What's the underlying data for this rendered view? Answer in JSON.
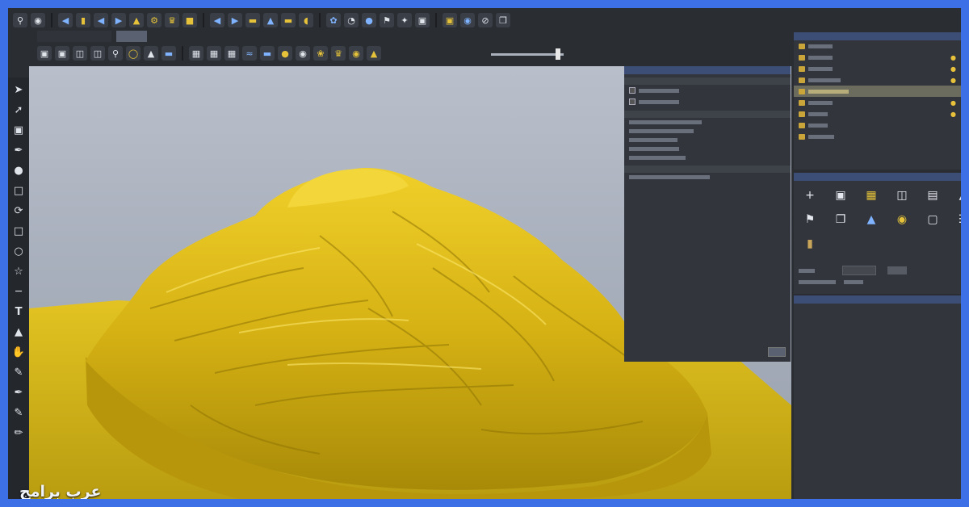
{
  "watermark": {
    "text": "عرب برامج"
  },
  "colors": {
    "frame": "#3d6fe6",
    "relief": "#d9b315",
    "bed": "#d8bd1a",
    "panel_title": "#3c4e76"
  },
  "toolbar": {
    "row1_icons": [
      "zoom-icon",
      "view-icon",
      "arrow-left-icon",
      "eraser-icon",
      "arrow-left-icon",
      "arrow-right-icon",
      "mound-icon",
      "gear-icon",
      "crown-icon",
      "box-icon",
      "arrow-left-icon",
      "arrow-right-icon",
      "layer-icon",
      "smooth-icon",
      "layer-icon",
      "blend-icon",
      "swirl-icon",
      "dome-icon",
      "sphere-icon",
      "pin-icon",
      "sparkle-icon",
      "cube-icon",
      "frame-icon",
      "bucket-icon",
      "block-icon",
      "copy-icon"
    ],
    "row2_icons": [
      "cube-icon",
      "cube-icon",
      "view-icon",
      "view-icon",
      "zoom-icon",
      "bulb-icon",
      "mound-icon",
      "layer-icon",
      "grid-icon",
      "grid-icon",
      "grid-icon",
      "wave-icon",
      "layer-icon",
      "sphere-icon",
      "cup-icon",
      "leaf-icon",
      "crown-icon",
      "cup-icon",
      "lamp-icon"
    ],
    "tabs": [
      "",
      ""
    ]
  },
  "left_tools": [
    "select-icon",
    "node-icon",
    "transform-icon",
    "pen-icon",
    "brush-icon",
    "crop-icon",
    "rotate-icon",
    "rect-icon",
    "ellipse-icon",
    "star-icon",
    "line-icon",
    "text-icon",
    "fill-icon",
    "hand-icon",
    "sculpt-icon",
    "knife-icon",
    "ruler-icon",
    "pencil-icon"
  ],
  "model_panel": {
    "sections": [
      {
        "title": ""
      },
      {
        "title": ""
      },
      {
        "title": ""
      }
    ],
    "rows": [
      "",
      "",
      "",
      "",
      "",
      "",
      "",
      ""
    ]
  },
  "project_panel": {
    "title": "",
    "items": [
      {
        "label": "",
        "selected": false
      },
      {
        "label": "",
        "selected": false
      },
      {
        "label": "",
        "selected": false
      },
      {
        "label": "",
        "selected": false
      },
      {
        "label": "",
        "selected": true
      },
      {
        "label": "",
        "selected": false
      },
      {
        "label": "",
        "selected": false
      },
      {
        "label": "",
        "selected": false
      },
      {
        "label": "",
        "selected": false
      }
    ]
  },
  "tools_panel": {
    "title": "",
    "icons": [
      "plus-icon",
      "frame-icon",
      "book-icon",
      "page-icon",
      "chart-icon",
      "lamp-icon",
      "pin-icon",
      "copy-icon",
      "mound-icon",
      "cup-icon",
      "phone-icon",
      "sliders-icon",
      "jar-icon"
    ]
  },
  "lower_panel": {
    "title": ""
  }
}
